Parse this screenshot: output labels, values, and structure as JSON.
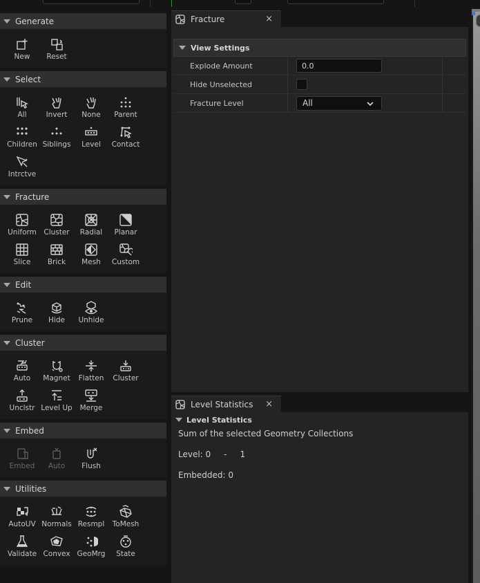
{
  "toolbox": {
    "categories": [
      {
        "name": "Generate",
        "tools": [
          {
            "label": "New",
            "icon": "new-icon"
          },
          {
            "label": "Reset",
            "icon": "reset-icon"
          }
        ]
      },
      {
        "name": "Select",
        "tools": [
          {
            "label": "All",
            "icon": "select-all-icon"
          },
          {
            "label": "Invert",
            "icon": "invert-icon"
          },
          {
            "label": "None",
            "icon": "select-none-icon"
          },
          {
            "label": "Parent",
            "icon": "parent-icon"
          },
          {
            "label": "Children",
            "icon": "children-icon"
          },
          {
            "label": "Siblings",
            "icon": "siblings-icon"
          },
          {
            "label": "Level",
            "icon": "level-icon"
          },
          {
            "label": "Contact",
            "icon": "contact-icon"
          },
          {
            "label": "Intrctve",
            "icon": "interactive-icon"
          }
        ]
      },
      {
        "name": "Fracture",
        "tools": [
          {
            "label": "Uniform",
            "icon": "uniform-icon"
          },
          {
            "label": "Cluster",
            "icon": "cluster-fracture-icon"
          },
          {
            "label": "Radial",
            "icon": "radial-icon"
          },
          {
            "label": "Planar",
            "icon": "planar-icon"
          },
          {
            "label": "Slice",
            "icon": "slice-icon"
          },
          {
            "label": "Brick",
            "icon": "brick-icon"
          },
          {
            "label": "Mesh",
            "icon": "mesh-icon"
          },
          {
            "label": "Custom",
            "icon": "custom-icon"
          }
        ]
      },
      {
        "name": "Edit",
        "tools": [
          {
            "label": "Prune",
            "icon": "prune-icon"
          },
          {
            "label": "Hide",
            "icon": "hide-icon"
          },
          {
            "label": "Unhide",
            "icon": "unhide-icon"
          }
        ]
      },
      {
        "name": "Cluster",
        "tools": [
          {
            "label": "Auto",
            "icon": "auto-cluster-icon"
          },
          {
            "label": "Magnet",
            "icon": "magnet-icon"
          },
          {
            "label": "Flatten",
            "icon": "flatten-icon"
          },
          {
            "label": "Cluster",
            "icon": "cluster-icon"
          },
          {
            "label": "Unclstr",
            "icon": "uncluster-icon"
          },
          {
            "label": "Level Up",
            "icon": "level-up-icon"
          },
          {
            "label": "Merge",
            "icon": "merge-icon"
          }
        ]
      },
      {
        "name": "Embed",
        "tools": [
          {
            "label": "Embed",
            "icon": "embed-icon",
            "disabled": true
          },
          {
            "label": "Auto",
            "icon": "auto-embed-icon",
            "disabled": true
          },
          {
            "label": "Flush",
            "icon": "flush-icon"
          }
        ]
      },
      {
        "name": "Utilities",
        "tools": [
          {
            "label": "AutoUV",
            "icon": "autouv-icon"
          },
          {
            "label": "Normals",
            "icon": "normals-icon"
          },
          {
            "label": "Resmpl",
            "icon": "resample-icon"
          },
          {
            "label": "ToMesh",
            "icon": "to-mesh-icon"
          },
          {
            "label": "Validate",
            "icon": "validate-icon"
          },
          {
            "label": "Convex",
            "icon": "convex-icon"
          },
          {
            "label": "GeoMrg",
            "icon": "geo-merge-icon"
          },
          {
            "label": "State",
            "icon": "state-icon"
          }
        ]
      }
    ]
  },
  "fracture_panel": {
    "tab_label": "Fracture",
    "close_glyph": "×",
    "section_title": "View Settings",
    "explode_label": "Explode Amount",
    "explode_value": "0.0",
    "hide_unselected_label": "Hide Unselected",
    "hide_unselected_checked": false,
    "fracture_level_label": "Fracture Level",
    "fracture_level_value": "All"
  },
  "stats_panel": {
    "tab_label": "Level Statistics",
    "close_glyph": "×",
    "section_title": "Level Statistics",
    "summary": "Sum of the selected Geometry Collections",
    "level_label": "Level: 0",
    "level_dash": "-",
    "level_count": "1",
    "embedded_text": "Embedded: 0"
  },
  "colors": {
    "accent": "#2f7de0",
    "panel_bg": "#242424",
    "toolbox_bg": "#1b1b1b",
    "header_bg": "#303030"
  }
}
